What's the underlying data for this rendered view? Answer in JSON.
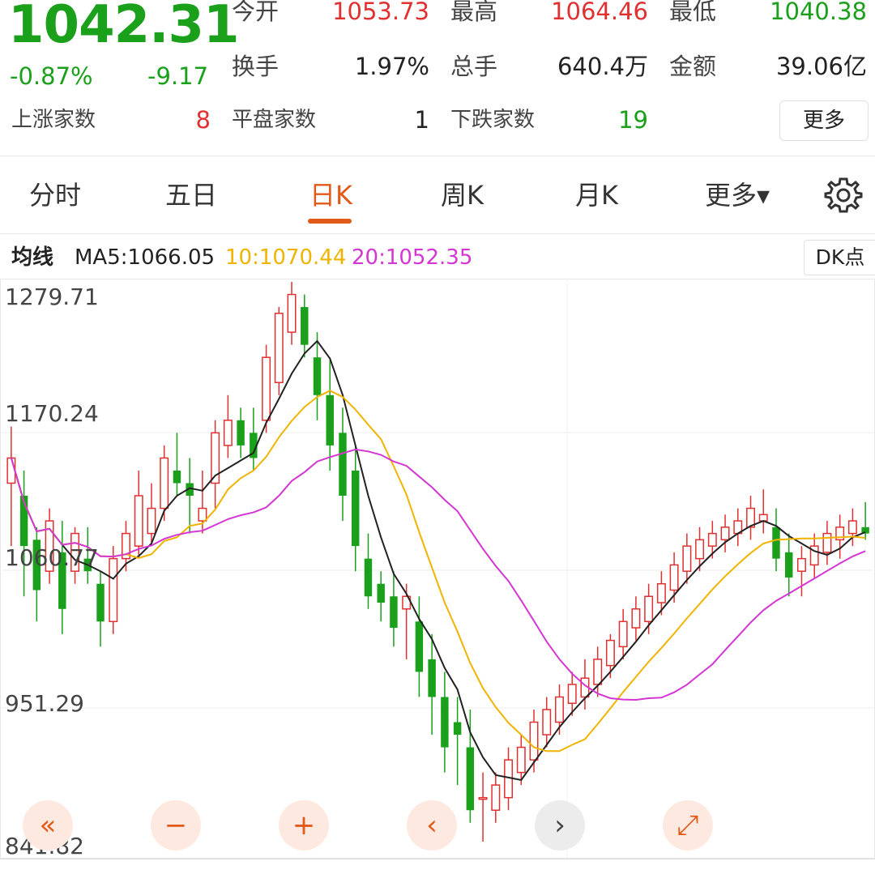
{
  "quote": {
    "price": "1042.31",
    "change_pct": "-0.87%",
    "change": "-9.17",
    "open_label": "今开",
    "open_value": "1053.73",
    "high_label": "最高",
    "high_value": "1064.46",
    "low_label": "最低",
    "low_value": "1040.38",
    "turnover_label": "换手",
    "turnover_value": "1.97%",
    "volume_label": "总手",
    "volume_value": "640.4万",
    "amount_label": "金额",
    "amount_value": "39.06亿",
    "up_label": "上涨家数",
    "up_value": "8",
    "flat_label": "平盘家数",
    "flat_value": "1",
    "down_label": "下跌家数",
    "down_value": "19",
    "more_label": "更多"
  },
  "tabs": [
    {
      "label": "分时",
      "active": false
    },
    {
      "label": "五日",
      "active": false
    },
    {
      "label": "日K",
      "active": true
    },
    {
      "label": "周K",
      "active": false
    },
    {
      "label": "月K",
      "active": false
    },
    {
      "label": "更多▾",
      "active": false
    }
  ],
  "settings_icon": "gear-icon",
  "ma": {
    "label": "均线",
    "ma5": "MA5:1066.05",
    "ma10": "10:1070.44",
    "ma20": "20:1052.35",
    "dk_label": "DK点"
  },
  "colors": {
    "up": "#e03030",
    "down": "#1aa01a",
    "ma5": "#222222",
    "ma10": "#f0b400",
    "ma20": "#d436d4",
    "accent": "#e25a1a"
  },
  "controls": [
    {
      "icon": "double-chevron-left-icon",
      "glyph": "«"
    },
    {
      "icon": "minus-icon",
      "glyph": "−"
    },
    {
      "icon": "plus-icon",
      "glyph": "+"
    },
    {
      "icon": "chevron-left-icon",
      "glyph": "‹"
    },
    {
      "icon": "chevron-right-icon",
      "glyph": "›"
    },
    {
      "icon": "expand-icon",
      "glyph": "⤢"
    }
  ],
  "chart_data": {
    "type": "candlestick",
    "y_ticks": [
      "1279.71",
      "1170.24",
      "1060.77",
      "951.29",
      "841.82"
    ],
    "ylim": [
      841.82,
      1279.71
    ],
    "candles": [
      [
        1130,
        1175,
        1080,
        1150
      ],
      [
        1120,
        1140,
        1040,
        1080
      ],
      [
        1085,
        1095,
        1020,
        1045
      ],
      [
        1060,
        1110,
        1050,
        1100
      ],
      [
        1075,
        1100,
        1010,
        1030
      ],
      [
        1060,
        1095,
        1050,
        1090
      ],
      [
        1070,
        1095,
        1050,
        1060
      ],
      [
        1050,
        1060,
        1000,
        1020
      ],
      [
        1020,
        1080,
        1010,
        1070
      ],
      [
        1070,
        1100,
        1060,
        1090
      ],
      [
        1080,
        1140,
        1070,
        1120
      ],
      [
        1090,
        1130,
        1080,
        1110
      ],
      [
        1110,
        1160,
        1100,
        1150
      ],
      [
        1140,
        1170,
        1120,
        1130
      ],
      [
        1130,
        1150,
        1090,
        1120
      ],
      [
        1100,
        1140,
        1090,
        1110
      ],
      [
        1130,
        1180,
        1110,
        1170
      ],
      [
        1160,
        1200,
        1150,
        1180
      ],
      [
        1180,
        1190,
        1150,
        1160
      ],
      [
        1170,
        1190,
        1140,
        1150
      ],
      [
        1180,
        1240,
        1170,
        1230
      ],
      [
        1210,
        1270,
        1200,
        1265
      ],
      [
        1250,
        1290,
        1240,
        1280
      ],
      [
        1270,
        1280,
        1230,
        1240
      ],
      [
        1230,
        1250,
        1180,
        1200
      ],
      [
        1200,
        1230,
        1140,
        1160
      ],
      [
        1170,
        1190,
        1100,
        1120
      ],
      [
        1140,
        1160,
        1060,
        1080
      ],
      [
        1070,
        1090,
        1030,
        1040
      ],
      [
        1050,
        1060,
        1020,
        1035
      ],
      [
        1040,
        1060,
        1000,
        1015
      ],
      [
        1030,
        1050,
        990,
        1040
      ],
      [
        1020,
        1040,
        960,
        980
      ],
      [
        990,
        1010,
        930,
        960
      ],
      [
        960,
        980,
        900,
        920
      ],
      [
        940,
        960,
        890,
        930
      ],
      [
        920,
        950,
        860,
        870
      ],
      [
        880,
        900,
        845,
        880
      ],
      [
        870,
        900,
        860,
        890
      ],
      [
        880,
        920,
        870,
        910
      ],
      [
        900,
        930,
        890,
        920
      ],
      [
        910,
        950,
        900,
        940
      ],
      [
        930,
        960,
        920,
        950
      ],
      [
        940,
        970,
        930,
        960
      ],
      [
        955,
        980,
        945,
        970
      ],
      [
        960,
        990,
        950,
        975
      ],
      [
        970,
        1000,
        960,
        990
      ],
      [
        985,
        1010,
        975,
        1005
      ],
      [
        1000,
        1030,
        990,
        1020
      ],
      [
        1015,
        1040,
        1005,
        1030
      ],
      [
        1020,
        1050,
        1010,
        1040
      ],
      [
        1035,
        1060,
        1025,
        1050
      ],
      [
        1045,
        1075,
        1035,
        1065
      ],
      [
        1060,
        1090,
        1050,
        1080
      ],
      [
        1070,
        1095,
        1060,
        1085
      ],
      [
        1080,
        1100,
        1070,
        1090
      ],
      [
        1085,
        1105,
        1075,
        1095
      ],
      [
        1090,
        1110,
        1080,
        1100
      ],
      [
        1095,
        1120,
        1085,
        1110
      ],
      [
        1100,
        1125,
        1090,
        1105
      ],
      [
        1095,
        1110,
        1060,
        1070
      ],
      [
        1075,
        1090,
        1040,
        1055
      ],
      [
        1060,
        1080,
        1040,
        1070
      ],
      [
        1065,
        1090,
        1055,
        1080
      ],
      [
        1075,
        1100,
        1065,
        1090
      ],
      [
        1085,
        1105,
        1070,
        1095
      ],
      [
        1090,
        1110,
        1080,
        1100
      ],
      [
        1095,
        1115,
        1085,
        1090
      ]
    ]
  }
}
